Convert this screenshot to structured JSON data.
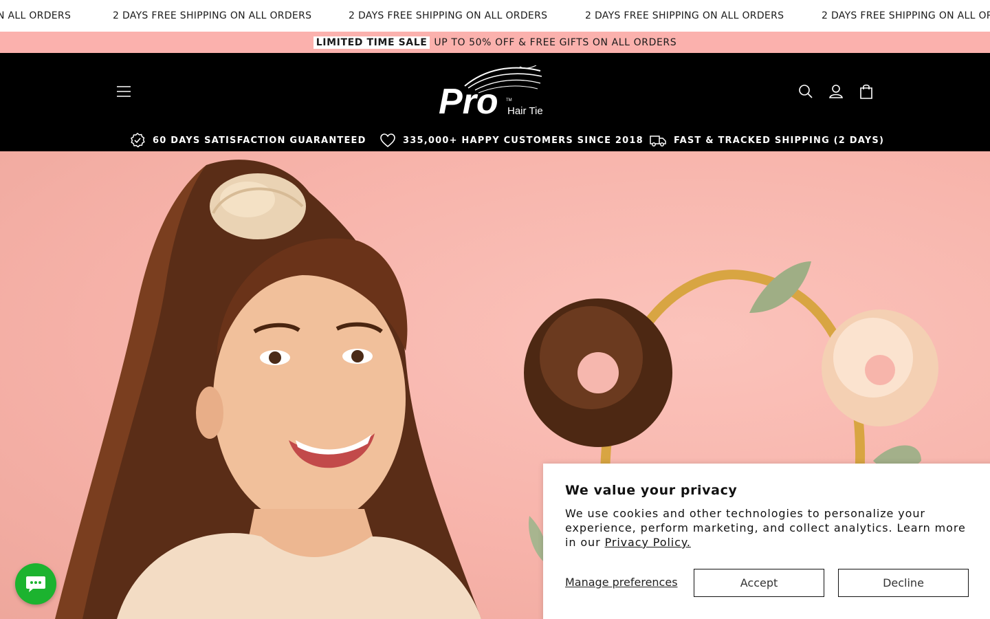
{
  "marquee": {
    "items": [
      "N ALL ORDERS",
      "2 DAYS FREE SHIPPING ON ALL ORDERS",
      "2 DAYS FREE SHIPPING ON ALL ORDERS",
      "2 DAYS FREE SHIPPING ON ALL ORDERS",
      "2 DAYS FREE SHIPPING ON ALL OR"
    ]
  },
  "sale_bar": {
    "badge": "LIMITED TIME SALE",
    "text": "UP TO 50% OFF & FREE GIFTS ON ALL ORDERS"
  },
  "header": {
    "logo_main": "Pro",
    "logo_sub": "Hair Tie",
    "logo_tm": "TM",
    "icons": [
      "menu-icon",
      "search-icon",
      "account-icon",
      "cart-icon"
    ]
  },
  "usps": [
    {
      "icon": "badge-check-icon",
      "label": "60 DAYS SATISFACTION GUARANTEED"
    },
    {
      "icon": "heart-icon",
      "label": "335,000+ HAPPY CUSTOMERS SINCE 2018"
    },
    {
      "icon": "truck-icon",
      "label": "FAST & TRACKED SHIPPING (2 DAYS)"
    }
  ],
  "cookie": {
    "title": "We value your privacy",
    "body": "We use cookies and other technologies to personalize your experience, perform marketing, and collect analytics. Learn more in our ",
    "link": "Privacy Policy.",
    "manage": "Manage preferences",
    "accept": "Accept",
    "decline": "Decline"
  },
  "chat": {
    "icon": "chat-icon"
  },
  "colors": {
    "sale_bar_bg": "#fbb1ad",
    "header_bg": "#000000",
    "hero_bg": "#f7b3aa",
    "chat_bg": "#1cb32f"
  }
}
